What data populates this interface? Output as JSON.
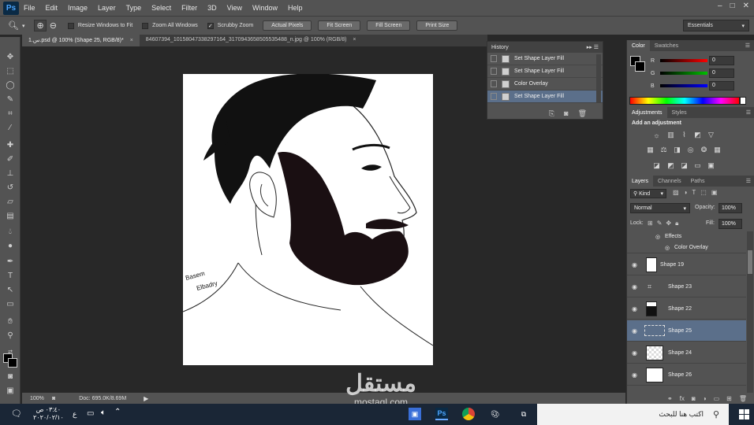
{
  "app": {
    "logo": "Ps",
    "menu": [
      "File",
      "Edit",
      "Image",
      "Layer",
      "Type",
      "Select",
      "Filter",
      "3D",
      "View",
      "Window",
      "Help"
    ],
    "window_controls": [
      "–",
      "□",
      "✕"
    ]
  },
  "options": {
    "resize_windows": "Resize Windows to Fit",
    "zoom_all": "Zoom All Windows",
    "scrubby_zoom": "Scrubby Zoom",
    "actual_pixels": "Actual Pixels",
    "fit_screen": "Fit Screen",
    "fill_screen": "Fill Screen",
    "print_size": "Print Size",
    "workspace": "Essentials"
  },
  "tabs": [
    {
      "label": "1.س.psd @ 100% (Shape 25, RGB/8)",
      "modified": "*"
    },
    {
      "label": "84607394_10158047338297164_3170943658505535488_n.jpg @ 100% (RGB/8)"
    }
  ],
  "artwork": {
    "signature_line1": "Basem",
    "signature_line2": "Elbadry"
  },
  "history": {
    "title": "History",
    "items": [
      "Set Shape Layer Fill",
      "Set Shape Layer Fill",
      "Color Overlay",
      "Set Shape Layer Fill"
    ]
  },
  "color_panel": {
    "tabs": [
      "Color",
      "Swatches"
    ],
    "sliders": [
      {
        "label": "R",
        "value": "0",
        "color": "#ff0000"
      },
      {
        "label": "G",
        "value": "0",
        "color": "#00c000"
      },
      {
        "label": "B",
        "value": "0",
        "color": "#0000ff"
      }
    ]
  },
  "adjustments": {
    "tabs": [
      "Adjustments",
      "Styles"
    ],
    "heading": "Add an adjustment"
  },
  "layers": {
    "tabs": [
      "Layers",
      "Channels",
      "Paths"
    ],
    "kind": "Kind",
    "blend_mode": "Normal",
    "opacity_label": "Opacity:",
    "opacity_value": "100%",
    "lock_label": "Lock:",
    "fill_label": "Fill:",
    "fill_value": "100%",
    "effects_label": "Effects",
    "color_overlay_label": "Color Overlay",
    "rows": [
      "Shape 19",
      "Shape 23",
      "Shape 22",
      "Shape 25",
      "Shape 24",
      "Shape 26"
    ]
  },
  "status": {
    "zoom": "100%",
    "doc_info": "Doc: 695.0K/8.69M"
  },
  "taskbar": {
    "search_placeholder": "اكتب هنا للبحث",
    "time": "٠٣:٤٠ ص",
    "date": "٢٠٢٠/٠٢/١٠",
    "lang": "ع"
  },
  "watermark": {
    "main": "مستقل",
    "sub": "mostaql.com"
  }
}
